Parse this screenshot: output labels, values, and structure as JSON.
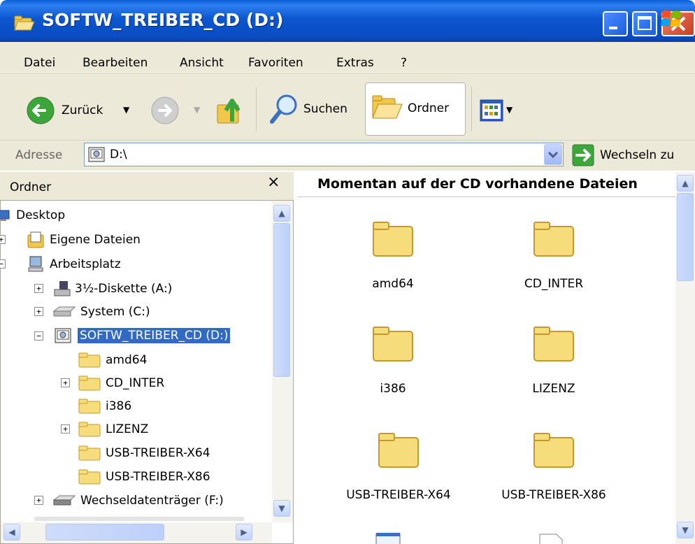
{
  "window": {
    "title": "SOFTW_TREIBER_CD (D:)"
  },
  "menu": {
    "items": [
      {
        "label": "Datei"
      },
      {
        "label": "Bearbeiten"
      },
      {
        "label": "Ansicht"
      },
      {
        "label": "Favoriten"
      },
      {
        "label": "Extras"
      },
      {
        "label": "?"
      }
    ]
  },
  "toolbar": {
    "back_label": "Zurück",
    "search_label": "Suchen",
    "folders_label": "Ordner"
  },
  "address": {
    "label": "Adresse",
    "value": "D:\\",
    "go_label": "Wechseln zu"
  },
  "folder_pane": {
    "title": "Ordner",
    "tree": [
      {
        "label": "Desktop",
        "icon": "desktop-icon"
      },
      {
        "label": "Eigene Dateien",
        "icon": "my-documents-icon"
      },
      {
        "label": "Arbeitsplatz",
        "icon": "my-computer-icon"
      },
      {
        "label": "3½-Diskette (A:)",
        "icon": "floppy-icon"
      },
      {
        "label": "System (C:)",
        "icon": "hard-drive-icon"
      },
      {
        "label": "SOFTW_TREIBER_CD (D:)",
        "icon": "cd-drive-icon",
        "selected": true
      },
      {
        "label": "amd64",
        "icon": "folder-icon"
      },
      {
        "label": "CD_INTER",
        "icon": "folder-icon"
      },
      {
        "label": "i386",
        "icon": "folder-icon"
      },
      {
        "label": "LIZENZ",
        "icon": "folder-icon"
      },
      {
        "label": "USB-TREIBER-X64",
        "icon": "folder-icon"
      },
      {
        "label": "USB-TREIBER-X86",
        "icon": "folder-icon"
      },
      {
        "label": "Wechseldatenträger (F:)",
        "icon": "removable-drive-icon"
      }
    ]
  },
  "content": {
    "header": "Momentan auf der CD vorhandene Dateien",
    "files": [
      {
        "label": "amd64",
        "icon": "folder-icon"
      },
      {
        "label": "CD_INTER",
        "icon": "folder-icon"
      },
      {
        "label": "i386",
        "icon": "folder-icon"
      },
      {
        "label": "LIZENZ",
        "icon": "folder-icon"
      },
      {
        "label": "USB-TREIBER-X64",
        "icon": "folder-icon"
      },
      {
        "label": "USB-TREIBER-X86",
        "icon": "folder-icon"
      }
    ]
  },
  "colors": {
    "titlebar": "#0a56cf",
    "selection": "#316ac5",
    "chrome": "#ece9d8",
    "folder_yellow": "#f7dc7c"
  }
}
